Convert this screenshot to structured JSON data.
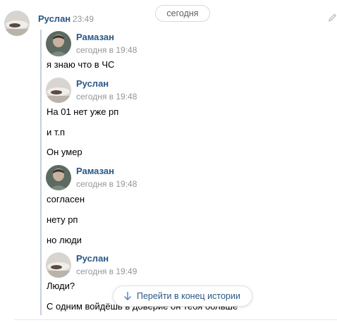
{
  "date_divider": "сегодня",
  "main_message": {
    "author": "Руслан",
    "time": "23:49"
  },
  "forwarded": [
    {
      "author": "Рамазан",
      "time": "сегодня в 19:48",
      "lines": [
        "я знаю что в ЧС"
      ]
    },
    {
      "author": "Руслан",
      "time": "сегодня в 19:48",
      "lines": [
        "На 01 нет уже рп",
        "и т.п",
        "Он умер"
      ]
    },
    {
      "author": "Рамазан",
      "time": "сегодня в 19:48",
      "lines": [
        "согласен",
        "нету рп",
        "но люди"
      ]
    },
    {
      "author": "Руслан",
      "time": "сегодня в 19:49",
      "lines": [
        "Люди?",
        "С одним войдёшь в доверие он тебя больше"
      ]
    }
  ],
  "jump_button": {
    "label": "Перейти в конец истории",
    "icon": "arrow-down-icon"
  },
  "icons": {
    "edit": "pencil-icon"
  },
  "colors": {
    "link": "#2a5885",
    "muted": "#939699",
    "quote_bar": "#c5d0db"
  }
}
